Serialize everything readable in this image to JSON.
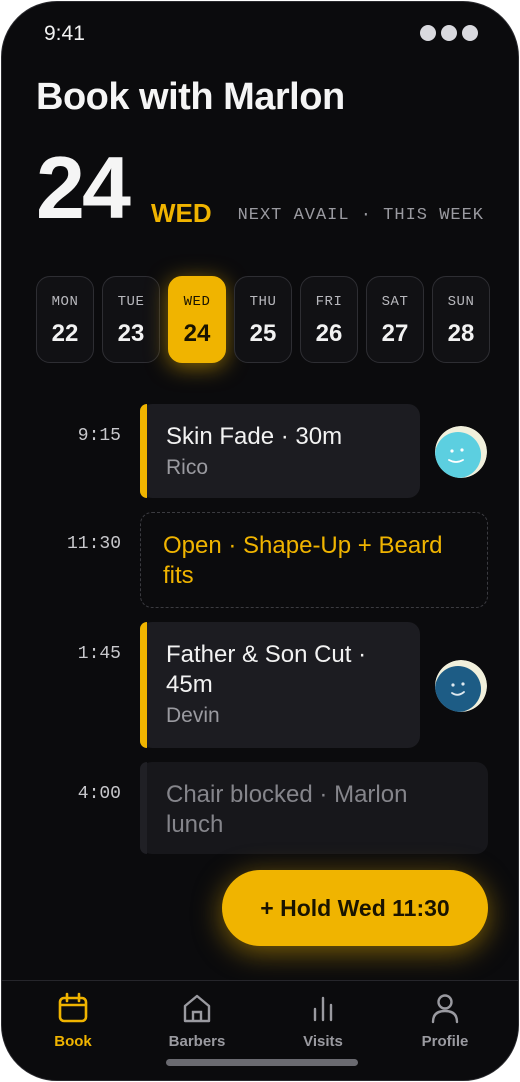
{
  "status_bar": {
    "time": "9:41"
  },
  "header": {
    "title": "Book with Marlon",
    "date_number": "24",
    "day_name": "WED",
    "availability_note": "NEXT AVAIL · THIS WEEK"
  },
  "week": [
    {
      "day": "MON",
      "date": "22",
      "selected": false
    },
    {
      "day": "TUE",
      "date": "23",
      "selected": false
    },
    {
      "day": "WED",
      "date": "24",
      "selected": true
    },
    {
      "day": "THU",
      "date": "25",
      "selected": false
    },
    {
      "day": "FRI",
      "date": "26",
      "selected": false
    },
    {
      "day": "SAT",
      "date": "27",
      "selected": false
    },
    {
      "day": "SUN",
      "date": "28",
      "selected": false
    }
  ],
  "schedule": [
    {
      "time": "9:15",
      "title": "Skin Fade · 30m",
      "client": "Rico",
      "status": "booked",
      "avatar": "client-avatar-icon"
    },
    {
      "time": "11:30",
      "title": "Open · Shape-Up + Beard fits",
      "status": "open"
    },
    {
      "time": "1:45",
      "title": "Father & Son Cut · 45m",
      "client": "Devin",
      "status": "booked",
      "avatar": "client-avatar-icon"
    },
    {
      "time": "4:00",
      "title": "Chair blocked · Marlon lunch",
      "status": "blocked"
    }
  ],
  "hold_button": {
    "label": "+ Hold Wed 11:30"
  },
  "tabs": [
    {
      "label": "Book",
      "icon": "calendar-icon",
      "active": true
    },
    {
      "label": "Barbers",
      "icon": "home-icon",
      "active": false
    },
    {
      "label": "Visits",
      "icon": "bar-chart-icon",
      "active": false
    },
    {
      "label": "Profile",
      "icon": "person-icon",
      "active": false
    }
  ],
  "colors": {
    "accent": "#f0b400",
    "background": "#0b0b0d",
    "card": "#1c1c21",
    "avatar_light": "#5ccfe0",
    "avatar_dark": "#1d5c85"
  }
}
